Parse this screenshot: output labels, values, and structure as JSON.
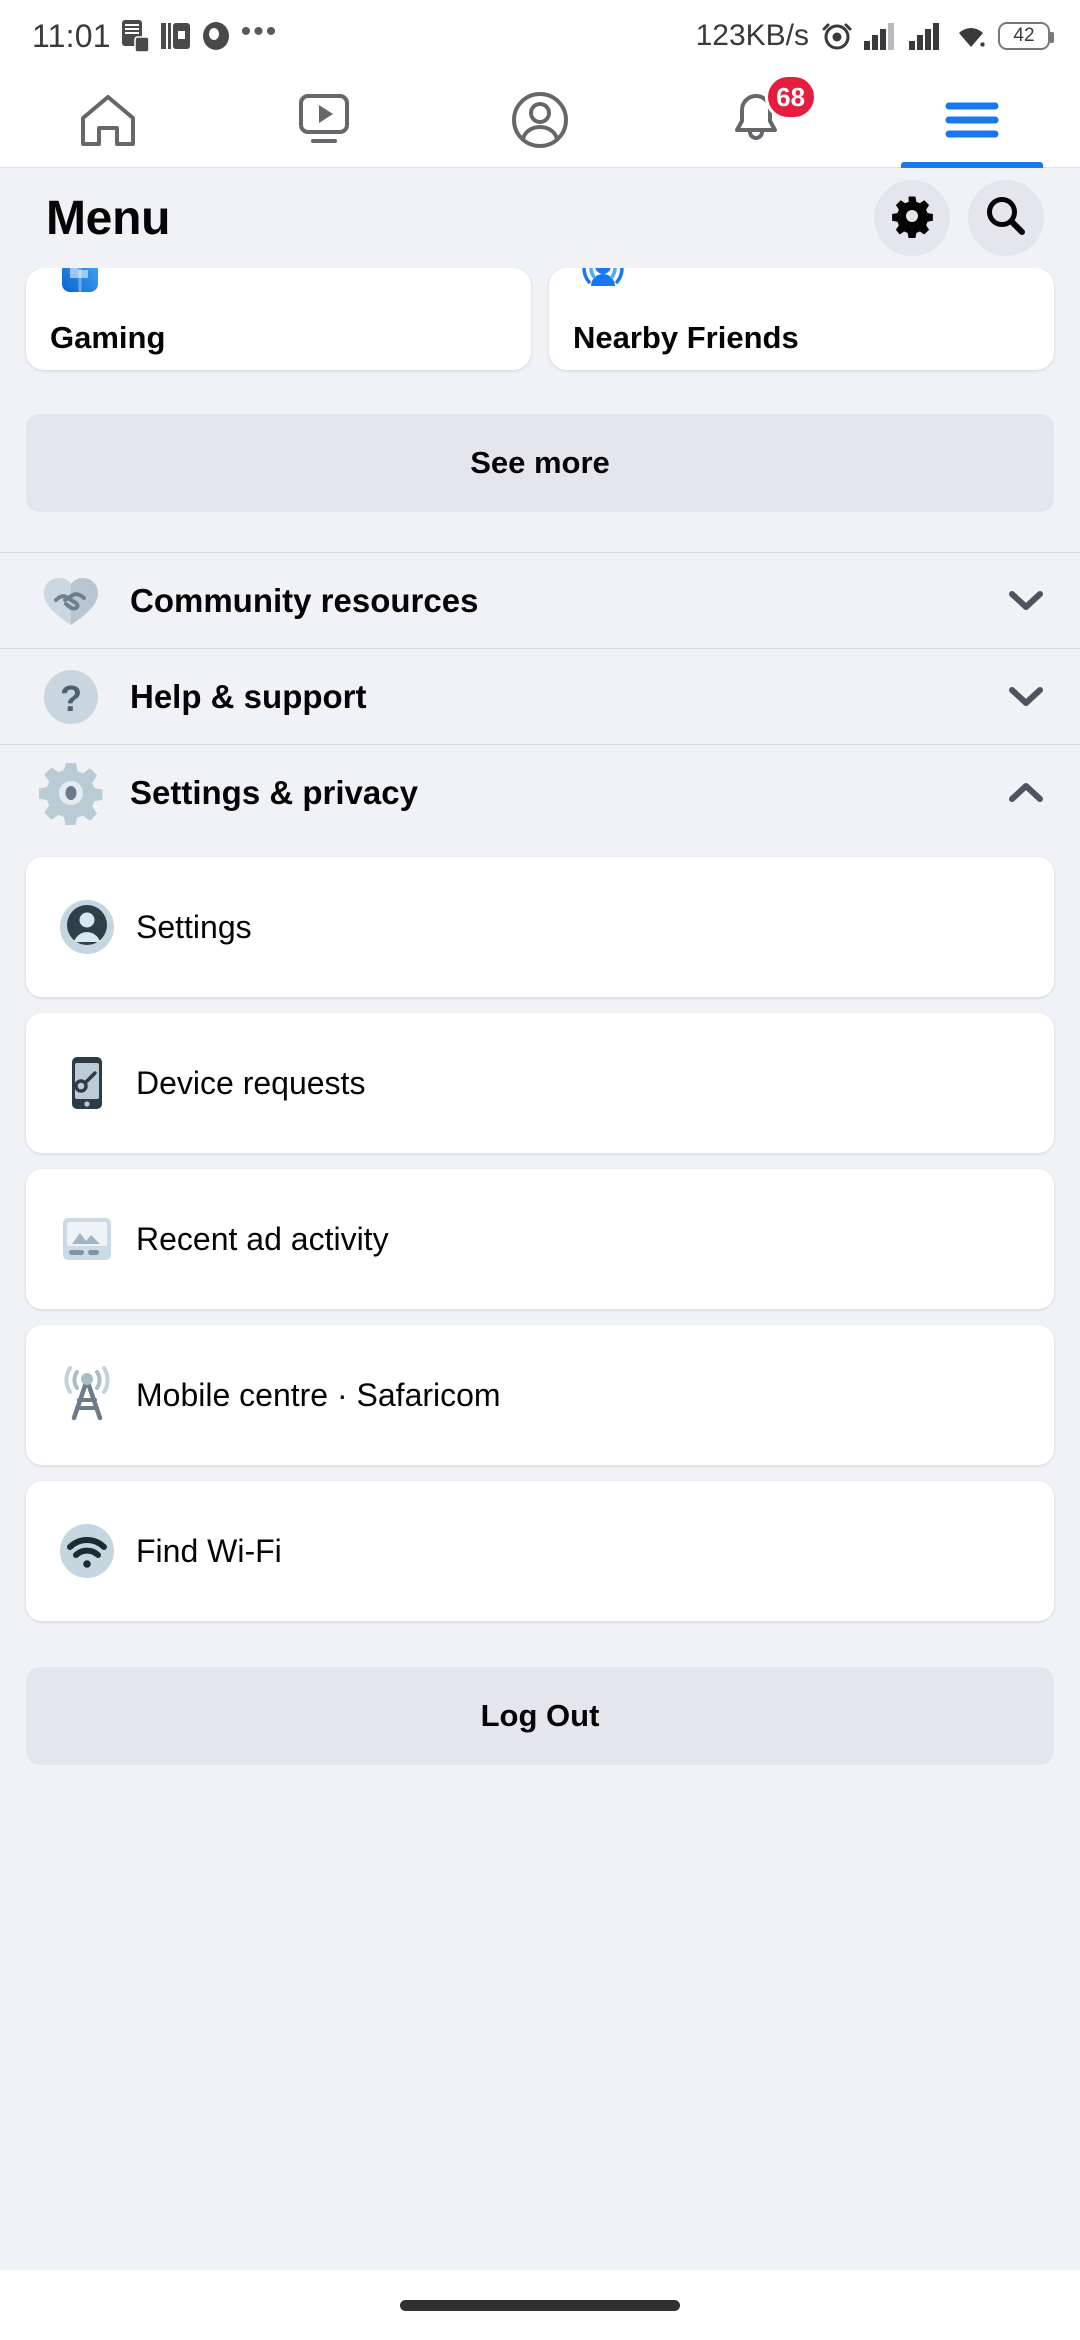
{
  "status_bar": {
    "time": "11:01",
    "overflow_dots": "•••",
    "network_speed": "123KB/s",
    "battery_level": "42",
    "icons": [
      "sd-card-icon",
      "battery-saver-icon",
      "vpn-icon",
      "overflow-dots-icon",
      "alarm-icon",
      "signal-sim1-icon",
      "signal-sim2-icon",
      "wifi-icon",
      "battery-icon"
    ]
  },
  "top_nav": {
    "tabs": [
      {
        "name": "home-tab",
        "icon": "home-icon",
        "active": false,
        "badge": ""
      },
      {
        "name": "video-tab",
        "icon": "video-icon",
        "active": false,
        "badge": ""
      },
      {
        "name": "profile-tab",
        "icon": "profile-icon",
        "active": false,
        "badge": ""
      },
      {
        "name": "notifications-tab",
        "icon": "bell-icon",
        "active": false,
        "badge": "68"
      },
      {
        "name": "menu-tab",
        "icon": "hamburger-icon",
        "active": true,
        "badge": ""
      }
    ],
    "active_color": "#1877F2",
    "badge_color": "#E41E3F"
  },
  "header": {
    "title": "Menu",
    "settings_icon": "gear-icon",
    "search_icon": "search-icon"
  },
  "shortcuts": {
    "cards": [
      {
        "label": "Gaming",
        "icon": "gaming-controller-icon"
      },
      {
        "label": "Nearby Friends",
        "icon": "nearby-friends-icon"
      }
    ],
    "see_more_label": "See more"
  },
  "sections": [
    {
      "label": "Community resources",
      "icon": "handshake-heart-icon",
      "expanded": false,
      "chevron": "chevron-down-icon"
    },
    {
      "label": "Help & support",
      "icon": "question-circle-icon",
      "expanded": false,
      "chevron": "chevron-down-icon"
    },
    {
      "label": "Settings & privacy",
      "icon": "gear-grey-icon",
      "expanded": true,
      "chevron": "chevron-up-icon"
    }
  ],
  "settings_items": [
    {
      "label": "Settings",
      "icon": "person-avatar-icon"
    },
    {
      "label": "Device requests",
      "icon": "phone-key-icon"
    },
    {
      "label": "Recent ad activity",
      "icon": "ad-card-icon"
    },
    {
      "label": "Mobile centre · Safaricom",
      "icon": "cell-tower-icon"
    },
    {
      "label": "Find Wi-Fi",
      "icon": "wifi-find-icon"
    }
  ],
  "logout_label": "Log Out",
  "colors": {
    "background": "#F0F2F5",
    "surface": "#FFFFFF",
    "button_grey": "#E4E6EB",
    "accent_blue": "#1877F2",
    "badge_red": "#E41E3F",
    "text_primary": "#050505"
  }
}
